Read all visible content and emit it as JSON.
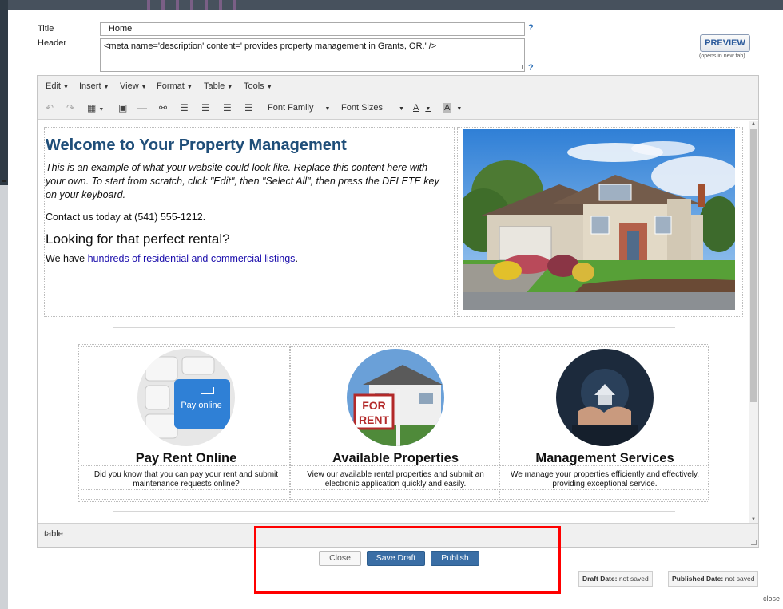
{
  "form": {
    "title_label": "Title",
    "header_label": "Header",
    "title_value": "| Home",
    "header_value": "<meta name='description' content=' provides property management in Grants, OR.' />",
    "help_mark": "?",
    "preview_label": "PREVIEW",
    "preview_note": "(opens in new tab)"
  },
  "menubar": [
    {
      "label": "Edit"
    },
    {
      "label": "Insert"
    },
    {
      "label": "View"
    },
    {
      "label": "Format"
    },
    {
      "label": "Table"
    },
    {
      "label": "Tools"
    }
  ],
  "toolbar": {
    "font_family": "Font Family",
    "font_sizes": "Font Sizes",
    "text_color_glyph": "A",
    "bg_color_glyph": "A"
  },
  "content": {
    "heading": "Welcome to Your Property Management",
    "intro": "This is an example of what your website could look like. Replace this content here with your own. To start from scratch, click \"Edit\", then \"Select All\", then press the DELETE key on your keyboard.",
    "contact": "Contact us today at (541) 555-1212.",
    "rental_heading": "Looking for that perfect rental?",
    "have_prefix": "We have ",
    "listings_link": "hundreds of residential and commercial listings",
    "have_suffix": ".",
    "features": [
      {
        "title": "Pay Rent Online",
        "desc": "Did you know that you can pay your rent and submit maintenance requests online?",
        "image_text": "Pay online"
      },
      {
        "title": "Available Properties",
        "desc": "View our available rental properties and submit an electronic application quickly and easily.",
        "image_text_1": "FOR",
        "image_text_2": "RENT"
      },
      {
        "title": "Management Services",
        "desc": "We manage your properties efficiently and effectively, providing exceptional service."
      }
    ]
  },
  "statusbar": {
    "path": "table"
  },
  "buttons": {
    "close": "Close",
    "save_draft": "Save Draft",
    "publish": "Publish"
  },
  "dates": {
    "draft_label": "Draft Date:",
    "draft_value": " not saved",
    "published_label": "Published Date:",
    "published_value": " not saved"
  },
  "footer": {
    "close_link": "close"
  },
  "colors": {
    "heading": "#1f4e79",
    "button": "#3a6ea5",
    "highlight_box": "#ff0000"
  }
}
